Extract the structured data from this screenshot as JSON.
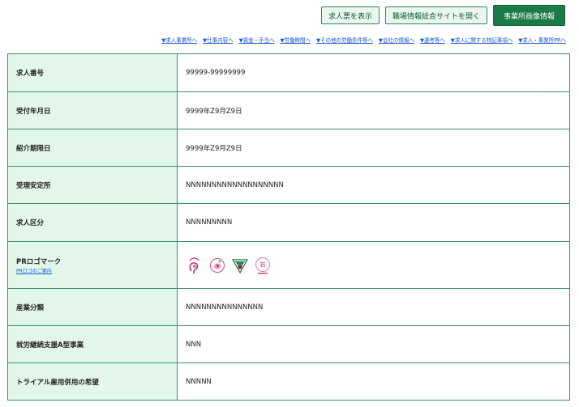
{
  "toolbar": {
    "show_job_label": "求人票を表示",
    "open_site_label": "職場情報総合サイトを開く",
    "office_image_label": "事業所画像情報"
  },
  "nav": [
    "▼求人事業所へ",
    "▼仕事内容へ",
    "▼賃金・手当へ",
    "▼労働時間へ",
    "▼その他の労働条件等へ",
    "▼会社の情報へ",
    "▼選考等へ",
    "▼求人に関する特記事項へ",
    "▼求人・事業所PRへ"
  ],
  "rows": [
    {
      "label": "求人番号",
      "value": "99999-99999999"
    },
    {
      "label": "受付年月日",
      "value": "9999年Z9月Z9日"
    },
    {
      "label": "紹介期限日",
      "value": "9999年Z9月Z9日"
    },
    {
      "label": "受理安定所",
      "value": "NNNNNNNNNNNNNNNNNNN"
    },
    {
      "label": "求人区分",
      "value": "NNNNNNNNN"
    },
    {
      "label": "PRロゴマーク",
      "sublabel": "PRロゴのご案内",
      "logos": [
        "kurumin-logo",
        "platinum-kurumin-logo",
        "eruboshi-logo",
        "youth-yell-logo"
      ]
    },
    {
      "label": "産業分類",
      "value": "NNNNNNNNNNNNNNN"
    },
    {
      "label": "就労継続支援A型事業",
      "value": "NNN"
    },
    {
      "label": "トライアル雇用併用の希望",
      "value": "NNNNN"
    }
  ],
  "colors": {
    "key_bg": "#e2f6ea",
    "border": "#3f8f68",
    "primary": "#1b7a45",
    "link": "#1a56c9"
  }
}
